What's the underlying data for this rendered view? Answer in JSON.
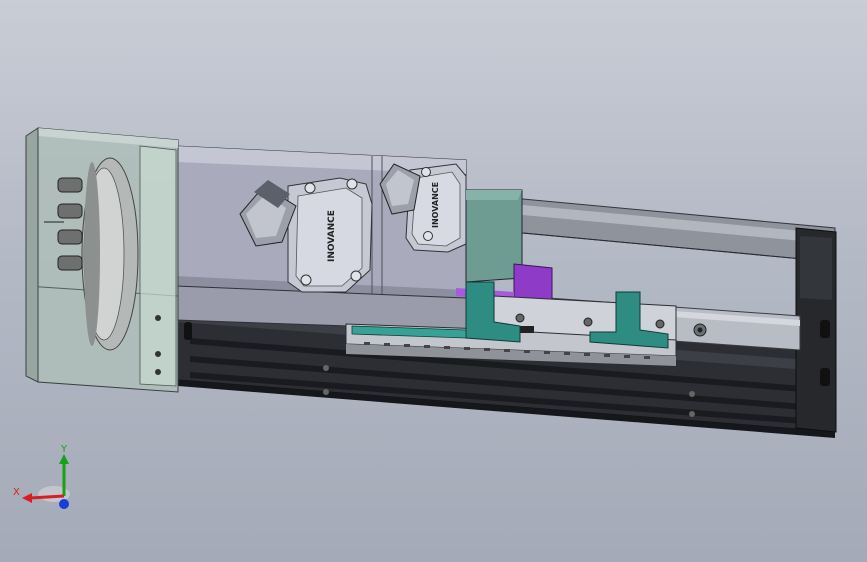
{
  "model": {
    "motor_brand_front": "INOVANCE",
    "motor_brand_rear": "INOVANCE"
  },
  "triad": {
    "x_label": "X",
    "y_label": "Y",
    "colors": {
      "x": "#d81e1e",
      "y": "#18a018",
      "z": "#1a3cd8"
    }
  },
  "colors": {
    "background_top": "#c9cdd6",
    "background_bottom": "#a4aab7",
    "motor_body": "#a9abbc",
    "linear_base": "#2a2c30",
    "carriage": "#2e8c82",
    "guard": "#a8b8b4",
    "accent": "#8e3cc8"
  }
}
